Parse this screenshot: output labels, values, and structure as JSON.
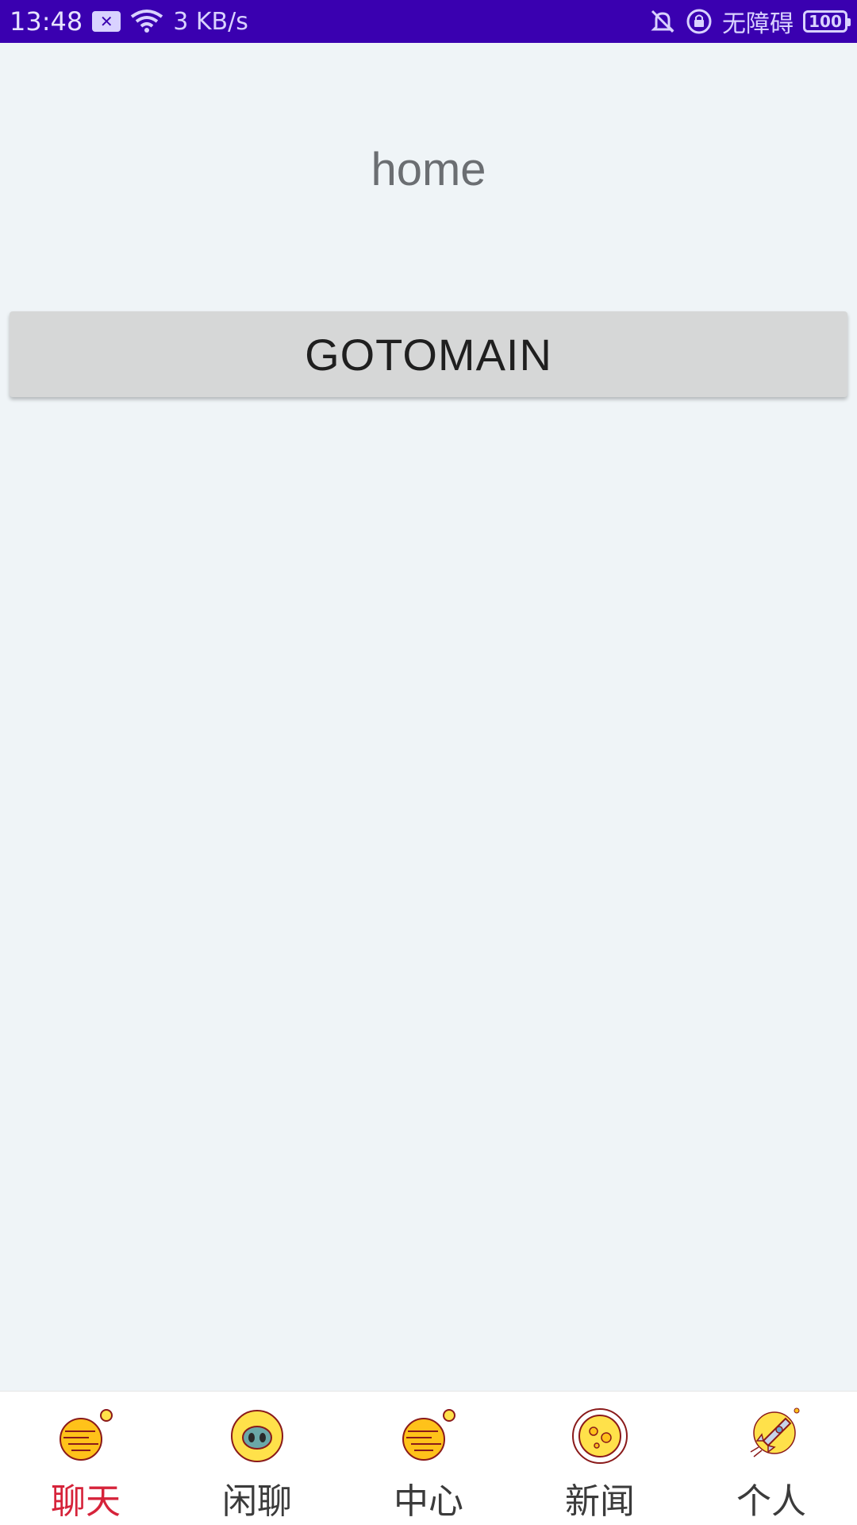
{
  "status_bar": {
    "time": "13:48",
    "notif_badge": "✕",
    "net_speed": "3 KB/s",
    "accessibility": "无障碍",
    "battery": "100"
  },
  "page": {
    "title": "home",
    "button_label": "GOTOMAIN"
  },
  "bottom_nav": {
    "items": [
      {
        "label": "聊天",
        "icon": "planet-icon",
        "active": true
      },
      {
        "label": "闲聊",
        "icon": "alien-icon",
        "active": false
      },
      {
        "label": "中心",
        "icon": "planet-icon",
        "active": false
      },
      {
        "label": "新闻",
        "icon": "moon-icon",
        "active": false
      },
      {
        "label": "个人",
        "icon": "rocket-icon",
        "active": false
      }
    ]
  },
  "colors": {
    "status_bar_bg": "#3a00b0",
    "active_tab": "#d6233a",
    "page_bg": "#eff4f7",
    "button_bg": "#d6d7d7"
  }
}
